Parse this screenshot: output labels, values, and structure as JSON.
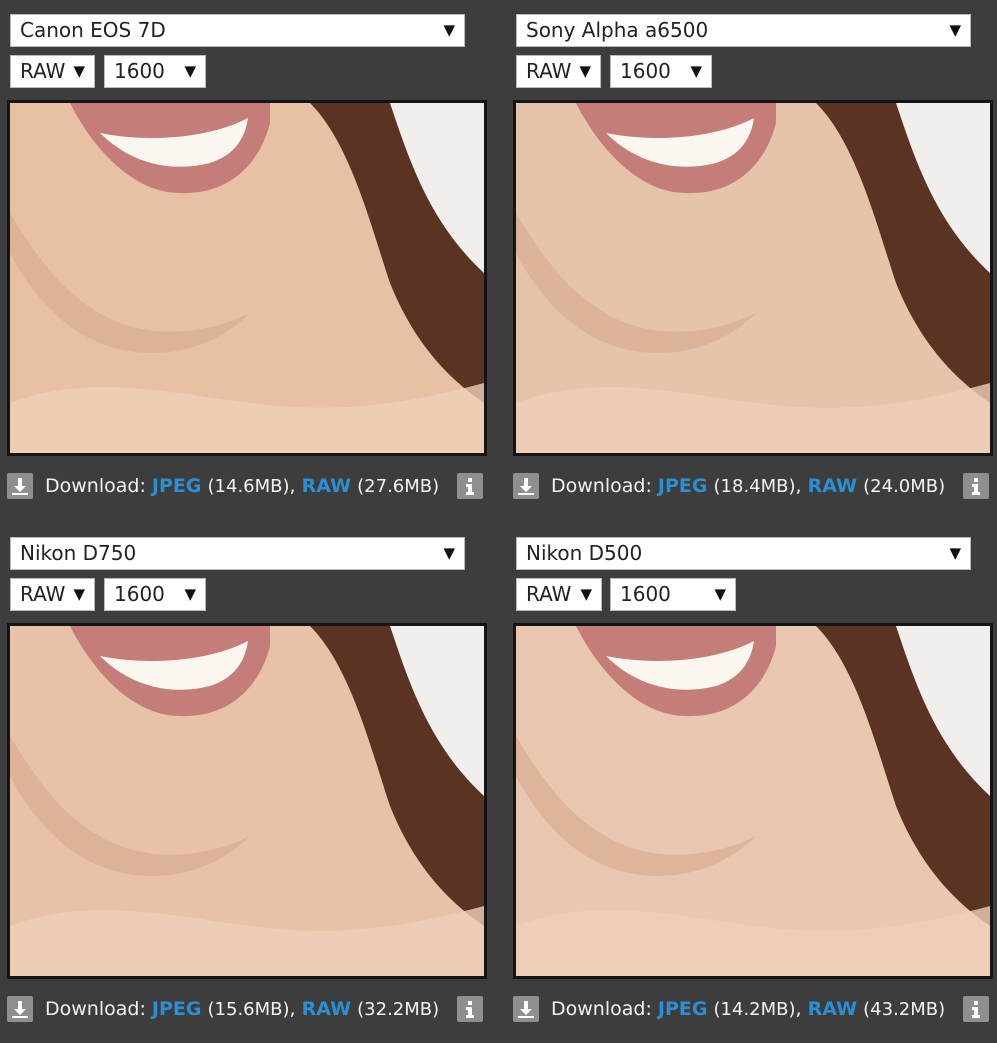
{
  "panels": [
    {
      "camera": "Canon EOS 7D",
      "mode": "RAW",
      "iso": "1600",
      "download_label": "Download:",
      "jpeg_label": "JPEG",
      "jpeg_size": "(14.6MB)",
      "raw_label": "RAW",
      "raw_size": "(27.6MB)"
    },
    {
      "camera": "Sony Alpha a6500",
      "mode": "RAW",
      "iso": "1600",
      "download_label": "Download:",
      "jpeg_label": "JPEG",
      "jpeg_size": "(18.4MB)",
      "raw_label": "RAW",
      "raw_size": "(24.0MB)"
    },
    {
      "camera": "Nikon D750",
      "mode": "RAW",
      "iso": "1600",
      "download_label": "Download:",
      "jpeg_label": "JPEG",
      "jpeg_size": "(15.6MB)",
      "raw_label": "RAW",
      "raw_size": "(32.2MB)"
    },
    {
      "camera": "Nikon D500",
      "mode": "RAW",
      "iso": "1600",
      "download_label": "Download:",
      "jpeg_label": "JPEG",
      "jpeg_size": "(14.2MB)",
      "raw_label": "RAW",
      "raw_size": "(43.2MB)"
    }
  ],
  "icons": {
    "dropdown": "triangle-down",
    "download": "download-arrow",
    "info": "info-i"
  },
  "colors": {
    "background": "#3d3d3d",
    "link": "#2a8fd3",
    "icon_bg": "#8f8f8f"
  }
}
